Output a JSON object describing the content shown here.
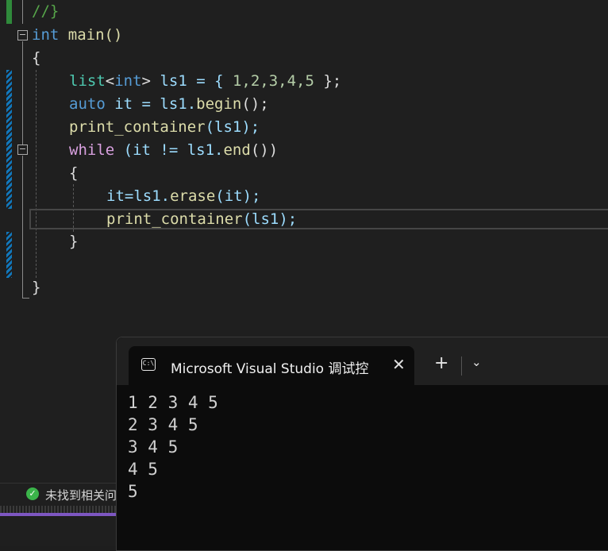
{
  "editor": {
    "lines": {
      "l0": "//}",
      "l1_kw": "int",
      "l1_rest": " main()",
      "l2": "{",
      "l3_type": "list",
      "l3_lt": "<",
      "l3_int": "int",
      "l3_gt": ">",
      "l3_rest1": " ls1 = { ",
      "l3_nums": "1,2,3,4,5",
      "l3_rest2": " };",
      "l4_kw": "auto",
      "l4_var": " it",
      "l4_rest": " = ls1.",
      "l4_fn": "begin",
      "l4_end": "();",
      "l5_fn": "print_container",
      "l5_rest": "(ls1);",
      "l6_kw": "while",
      "l6_rest1": " (it != ls1.",
      "l6_fn": "end",
      "l6_rest2": "())",
      "l7": "{",
      "l8_a": "it=ls1.",
      "l8_fn": "erase",
      "l8_b": "(it);",
      "l9_fn": "print_container",
      "l9_rest": "(ls1);",
      "l10": "}",
      "l11": "}"
    }
  },
  "status": {
    "text": "未找到相关问题"
  },
  "terminal": {
    "tab_title": "Microsoft Visual Studio 调试控制台",
    "tab_icon": "C:\\",
    "close_glyph": "✕",
    "new_tab_glyph": "+",
    "dropdown_glyph": "⌄",
    "output": [
      "1 2 3 4 5",
      "2 3 4 5",
      "3 4 5",
      "4 5",
      "5"
    ]
  },
  "colors": {
    "keyword": "#569cd6",
    "control": "#d8a0df",
    "function": "#dcdcaa",
    "number": "#b5cea8",
    "comment": "#57a64a",
    "change_marker": "#1177bb"
  }
}
